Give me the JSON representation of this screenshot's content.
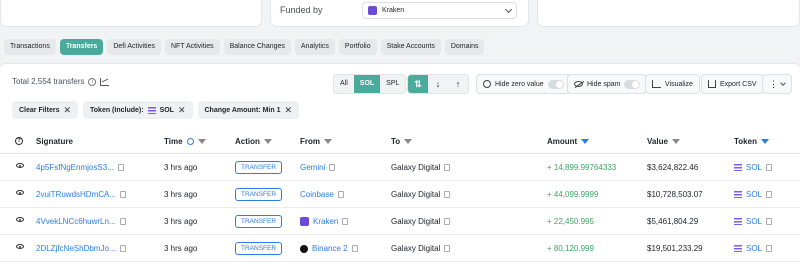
{
  "funded": {
    "label": "Funded by",
    "value": "Kraken"
  },
  "tabs": [
    "Transactions",
    "Transfers",
    "Defi Activities",
    "NFT Activities",
    "Balance Changes",
    "Analytics",
    "Portfolio",
    "Stake Accounts",
    "Domains"
  ],
  "toolbar": {
    "total": "Total 2,554 transfers",
    "filter_all": "All",
    "filter_sol": "SOL",
    "filter_spl": "SPL",
    "hide_zero": "Hide zero value",
    "hide_spam": "Hide spam",
    "visualize": "Visualize",
    "export": "Export CSV"
  },
  "chips": {
    "clear": "Clear Filters",
    "token_prefix": "Token (Include):",
    "token_value": "SOL",
    "amount": "Change Amount: Min 1"
  },
  "columns": {
    "signature": "Signature",
    "time": "Time",
    "action": "Action",
    "from": "From",
    "to": "To",
    "amount": "Amount",
    "value": "Value",
    "token": "Token"
  },
  "rows": [
    {
      "signature": "4p5FsfNgEnmjosS3...",
      "time": "3 hrs ago",
      "action": "TRANSFER",
      "from": "Gemini",
      "to": "Galaxy Digital",
      "amount": "+ 14,899.99764333",
      "value": "$3,624,822.46",
      "token": "SOL"
    },
    {
      "signature": "2vuiTRuwdsHDmCA...",
      "time": "3 hrs ago",
      "action": "TRANSFER",
      "from": "Coinbase",
      "to": "Galaxy Digital",
      "amount": "+ 44,099.9999",
      "value": "$10,728,503.07",
      "token": "SOL"
    },
    {
      "signature": "4VvekLNCc6huwrLn...",
      "time": "3 hrs ago",
      "action": "TRANSFER",
      "from": "Kraken",
      "to": "Galaxy Digital",
      "amount": "+ 22,450.995",
      "value": "$5,461,804.29",
      "token": "SOL"
    },
    {
      "signature": "2DLZjfcNeShDbmJo...",
      "time": "3 hrs ago",
      "action": "TRANSFER",
      "from": "Binance 2",
      "to": "Galaxy Digital",
      "amount": "+ 80,120.999",
      "value": "$19,501,233.29",
      "token": "SOL"
    }
  ],
  "colors": {
    "accent": "#4aaa9b",
    "link": "#2b7de9",
    "positive": "#3fa265"
  }
}
